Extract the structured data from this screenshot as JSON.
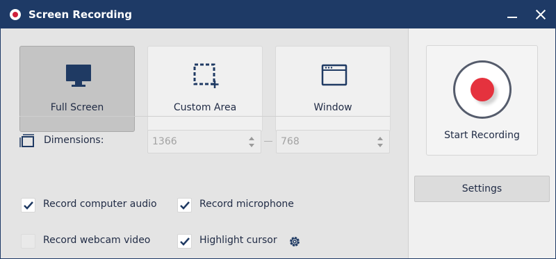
{
  "window": {
    "title": "Screen Recording"
  },
  "modes": [
    {
      "label": "Full Screen",
      "active": true
    },
    {
      "label": "Custom Area",
      "active": false
    },
    {
      "label": "Window",
      "active": false
    }
  ],
  "dimensions": {
    "label": "Dimensions:",
    "width": "1366",
    "height": "768"
  },
  "options": {
    "record_audio": {
      "label": "Record computer audio",
      "checked": true
    },
    "record_mic": {
      "label": "Record microphone",
      "checked": true
    },
    "record_webcam": {
      "label": "Record webcam video",
      "checked": false
    },
    "highlight_cursor": {
      "label": "Highlight cursor",
      "checked": true
    }
  },
  "actions": {
    "start_label": "Start Recording",
    "settings_label": "Settings"
  },
  "colors": {
    "titlebar": "#1e3a66",
    "text": "#1f2a44",
    "record_red": "#e5323e",
    "active_mode_bg": "#c4c4c4"
  },
  "icons": {
    "app": "record-icon",
    "full_screen": "monitor-icon",
    "custom_area": "custom-area-icon",
    "window": "window-icon",
    "dimensions": "dimensions-icon",
    "settings": "gear-icon"
  }
}
